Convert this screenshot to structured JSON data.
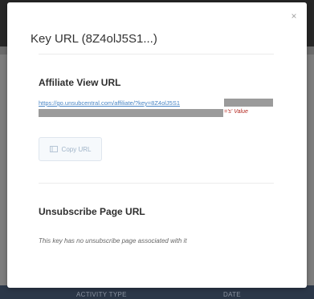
{
  "background": {
    "footer_col_left": "ACTIVITY TYPE",
    "footer_col_right": "DATE"
  },
  "modal": {
    "title": "Key URL (8Z4olJ5S1...)",
    "close_icon": "×",
    "affiliate_section": {
      "title": "Affiliate View URL",
      "url": "https://go.unsubcentral.com/affiliate/?key=8Z4olJ5S1",
      "s_value_note": "='s' Value",
      "copy_button_label": "Copy URL",
      "copy_icon": "clipboard-icon"
    },
    "unsubscribe_section": {
      "title": "Unsubscribe Page URL",
      "empty_message": "This key has no unsubscribe page associated with it"
    }
  },
  "colors": {
    "link": "#4a86c5",
    "note_red": "#b3261e",
    "button_text": "#9fb3c8",
    "overlay": "#7d7d7d"
  }
}
